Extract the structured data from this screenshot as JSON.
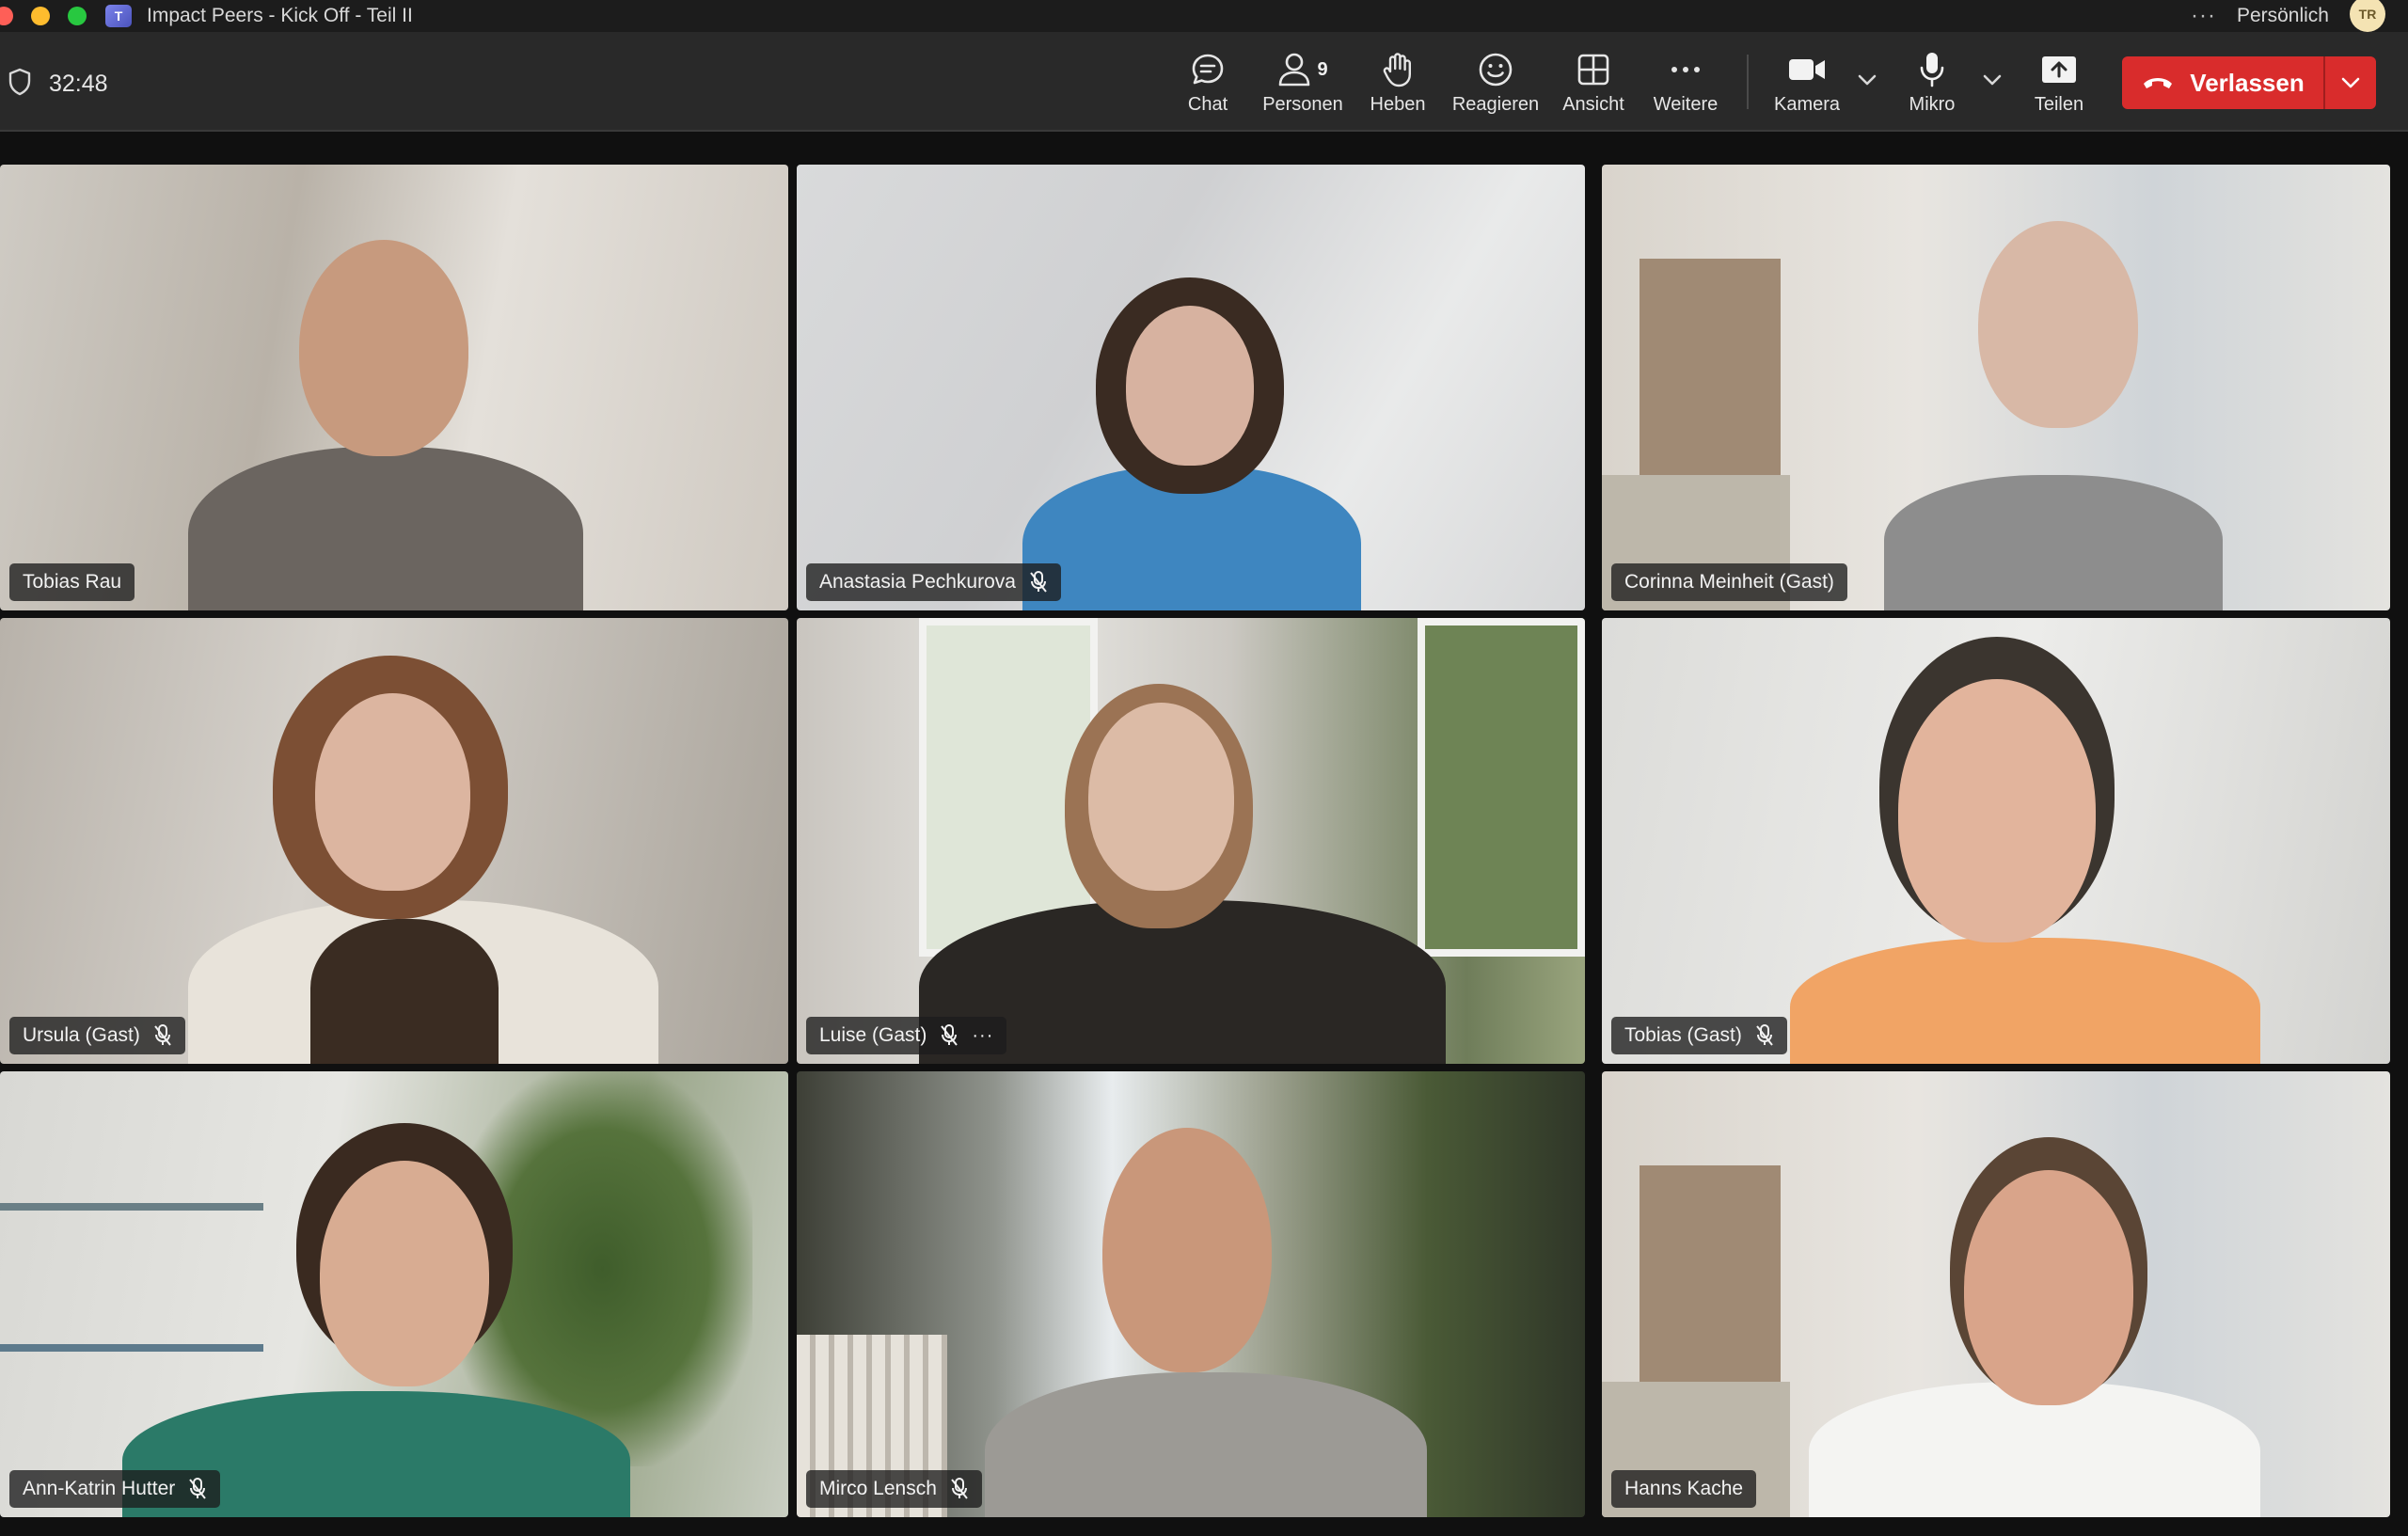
{
  "window": {
    "title": "Impact Peers - Kick Off - Teil II",
    "profile_label": "Persönlich",
    "avatar_initials": "TR"
  },
  "toolbar": {
    "timer": "32:48",
    "chat_label": "Chat",
    "people_label": "Personen",
    "people_count": "9",
    "raise_label": "Heben",
    "react_label": "Reagieren",
    "view_label": "Ansicht",
    "more_label": "Weitere",
    "camera_label": "Kamera",
    "mic_label": "Mikro",
    "share_label": "Teilen",
    "leave_label": "Verlassen"
  },
  "participants": [
    {
      "name": "Tobias Rau",
      "muted": false
    },
    {
      "name": "Anastasia Pechkurova",
      "muted": true
    },
    {
      "name": "Corinna Meinheit (Gast)",
      "muted": false
    },
    {
      "name": "Ursula (Gast)",
      "muted": true
    },
    {
      "name": "Luise (Gast)",
      "muted": true
    },
    {
      "name": "Tobias (Gast)",
      "muted": true
    },
    {
      "name": "Ann-Katrin Hutter",
      "muted": true
    },
    {
      "name": "Mirco Lensch",
      "muted": true
    },
    {
      "name": "Hanns Kache",
      "muted": false
    }
  ],
  "colors": {
    "leave_button": "#d92c2c",
    "toolbar_bg": "#292929",
    "titlebar_bg": "#1c1c1c"
  }
}
